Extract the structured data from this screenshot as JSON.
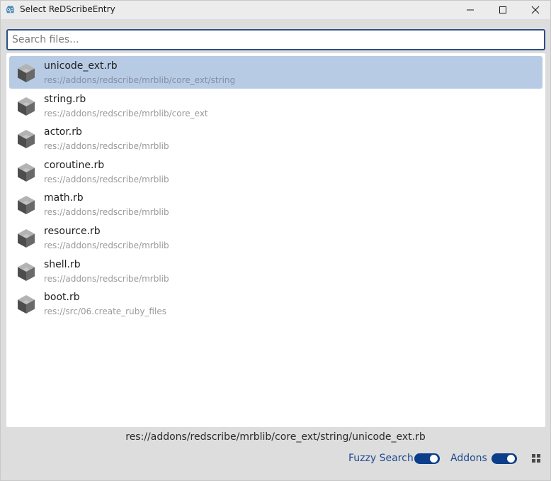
{
  "window": {
    "title": "Select ReDScribeEntry",
    "icons": [
      "godot-icon",
      "minimize-icon",
      "maximize-icon",
      "close-icon"
    ]
  },
  "search": {
    "value": "",
    "placeholder": "Search files..."
  },
  "files": [
    {
      "name": "unicode_ext.rb",
      "path": "res://addons/redscribe/mrblib/core_ext/string",
      "selected": true
    },
    {
      "name": "string.rb",
      "path": "res://addons/redscribe/mrblib/core_ext",
      "selected": false
    },
    {
      "name": "actor.rb",
      "path": "res://addons/redscribe/mrblib",
      "selected": false
    },
    {
      "name": "coroutine.rb",
      "path": "res://addons/redscribe/mrblib",
      "selected": false
    },
    {
      "name": "math.rb",
      "path": "res://addons/redscribe/mrblib",
      "selected": false
    },
    {
      "name": "resource.rb",
      "path": "res://addons/redscribe/mrblib",
      "selected": false
    },
    {
      "name": "shell.rb",
      "path": "res://addons/redscribe/mrblib",
      "selected": false
    },
    {
      "name": "boot.rb",
      "path": "res://src/06.create_ruby_files",
      "selected": false
    }
  ],
  "footer": {
    "selected_path": "res://addons/redscribe/mrblib/core_ext/string/unicode_ext.rb",
    "fuzzy_label": "Fuzzy Search",
    "fuzzy_on": true,
    "addons_label": "Addons",
    "addons_on": true
  },
  "colors": {
    "accent": "#0c3d8a",
    "selection": "#b8cbe4",
    "search_border": "#2c4f87"
  }
}
